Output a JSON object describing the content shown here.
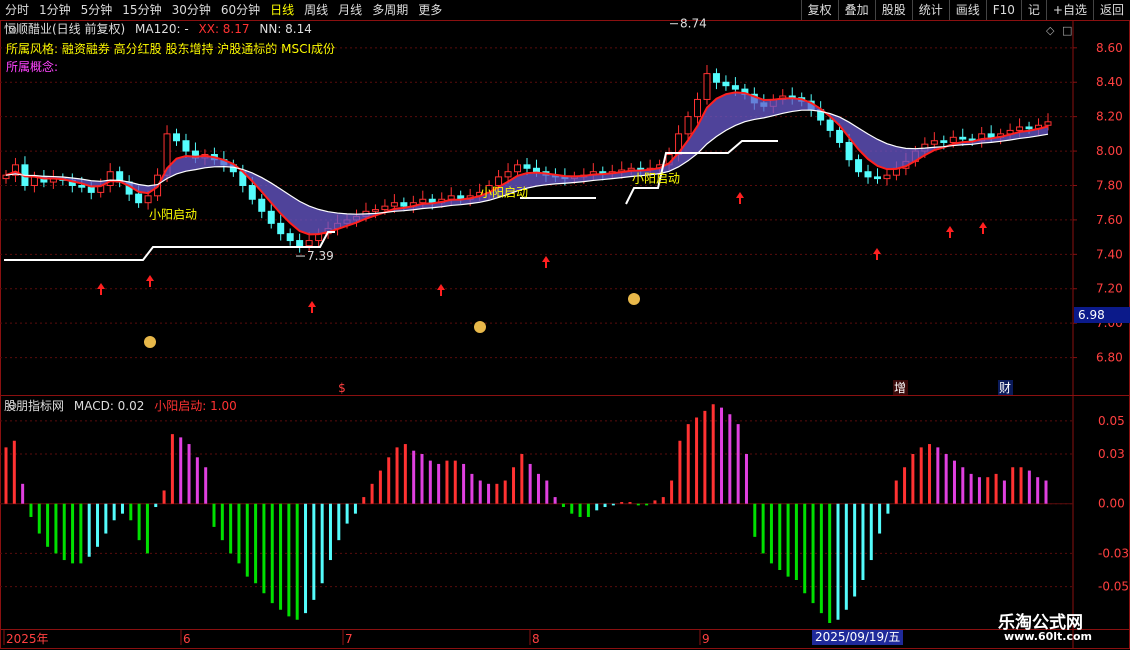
{
  "toolbar": {
    "periods": [
      "分时",
      "1分钟",
      "5分钟",
      "15分钟",
      "30分钟",
      "60分钟",
      "日线",
      "周线",
      "月线",
      "多周期",
      "更多"
    ],
    "active": "日线",
    "buttons": [
      "复权",
      "叠加",
      "股股",
      "统计",
      "画线",
      "F10",
      "记",
      "+自选",
      "返回"
    ]
  },
  "info": {
    "stock": "恒顺醋业(日线 前复权)",
    "ma": "MA120: -",
    "xx": "XX: 8.17",
    "nn": "NN: 8.14"
  },
  "tags": {
    "line1": "所属风格:  融资融券 高分红股 股东增持 沪股通标的 MSCI成份",
    "line2": "所属概念:"
  },
  "lower": {
    "name": "股朋指标网",
    "macd": "MACD: 0.02",
    "signal": "小阳启动: 1.00"
  },
  "price_tag": "6.98",
  "date_highlight": "2025/09/19/五",
  "watermark": {
    "line1": "乐淘公式网",
    "line2": "www.60lt.com"
  },
  "colors": {
    "up": "#ff3232",
    "down": "#54fcfc",
    "macd_up": "#ff3232",
    "macd_up2": "#e040e0",
    "macd_down": "#00e000",
    "macd_down2": "#54fcfc"
  },
  "chart_data": [
    {
      "type": "candlestick",
      "title": "",
      "ylim": [
        6.6,
        8.75
      ],
      "y_ticks": [
        6.8,
        7.0,
        7.2,
        7.4,
        7.6,
        7.8,
        8.0,
        8.2,
        8.4,
        8.6
      ],
      "x_labels": [
        "2025年",
        "6",
        "7",
        "8",
        "9"
      ],
      "close_estimate": [
        7.86,
        7.92,
        7.8,
        7.85,
        7.82,
        7.84,
        7.83,
        7.8,
        7.79,
        7.76,
        7.8,
        7.88,
        7.82,
        7.75,
        7.7,
        7.74,
        7.86,
        8.1,
        8.06,
        8.0,
        7.96,
        7.98,
        7.95,
        7.92,
        7.88,
        7.8,
        7.72,
        7.65,
        7.58,
        7.52,
        7.48,
        7.45,
        7.48,
        7.52,
        7.55,
        7.58,
        7.6,
        7.62,
        7.65,
        7.66,
        7.68,
        7.7,
        7.68,
        7.7,
        7.72,
        7.7,
        7.72,
        7.74,
        7.72,
        7.74,
        7.76,
        7.8,
        7.85,
        7.88,
        7.92,
        7.9,
        7.88,
        7.86,
        7.85,
        7.84,
        7.85,
        7.86,
        7.88,
        7.87,
        7.88,
        7.89,
        7.9,
        7.89,
        7.9,
        7.92,
        7.98,
        8.1,
        8.2,
        8.3,
        8.45,
        8.4,
        8.38,
        8.36,
        8.33,
        8.28,
        8.26,
        8.3,
        8.32,
        8.31,
        8.29,
        8.24,
        8.18,
        8.12,
        8.05,
        7.95,
        7.88,
        7.85,
        7.84,
        7.86,
        7.9,
        7.94,
        8.0,
        8.04,
        8.06,
        8.05,
        8.08,
        8.07,
        8.06,
        8.1,
        8.08,
        8.1,
        8.12,
        8.14,
        8.13,
        8.15,
        8.17
      ],
      "annotations": [
        {
          "label": "8.74",
          "value": 8.74
        },
        {
          "label": "7.39",
          "value": 7.39
        },
        {
          "label": "小阳启动",
          "value": 7.63
        },
        {
          "label": "小阳启动",
          "value": 7.76
        },
        {
          "label": "小阳启动",
          "value": 7.84
        }
      ],
      "markers": [
        "$",
        "增",
        "财"
      ]
    },
    {
      "type": "bar",
      "title": "",
      "ylim": [
        -0.075,
        0.065
      ],
      "y_ticks": [
        0.05,
        0.03,
        0.0,
        -0.03,
        -0.05
      ],
      "values": [
        0.034,
        0.038,
        0.012,
        -0.008,
        -0.018,
        -0.026,
        -0.03,
        -0.034,
        -0.036,
        -0.036,
        -0.032,
        -0.026,
        -0.018,
        -0.01,
        -0.006,
        -0.01,
        -0.022,
        -0.03,
        -0.002,
        0.008,
        0.042,
        0.04,
        0.036,
        0.028,
        0.022,
        -0.014,
        -0.022,
        -0.03,
        -0.036,
        -0.044,
        -0.048,
        -0.054,
        -0.06,
        -0.064,
        -0.068,
        -0.07,
        -0.066,
        -0.058,
        -0.048,
        -0.034,
        -0.022,
        -0.012,
        -0.006,
        0.004,
        0.012,
        0.02,
        0.028,
        0.034,
        0.036,
        0.032,
        0.03,
        0.026,
        0.024,
        0.026,
        0.026,
        0.024,
        0.018,
        0.014,
        0.012,
        0.012,
        0.014,
        0.022,
        0.03,
        0.024,
        0.018,
        0.014,
        0.004,
        -0.002,
        -0.006,
        -0.008,
        -0.008,
        -0.004,
        -0.002,
        -0.001,
        0.001,
        0.001,
        -0.001,
        -0.001,
        0.002,
        0.004,
        0.014,
        0.038,
        0.048,
        0.052,
        0.056,
        0.06,
        0.058,
        0.054,
        0.048,
        0.03,
        -0.02,
        -0.03,
        -0.036,
        -0.04,
        -0.044,
        -0.046,
        -0.054,
        -0.06,
        -0.066,
        -0.072,
        -0.07,
        -0.064,
        -0.056,
        -0.046,
        -0.034,
        -0.018,
        -0.006,
        0.014,
        0.022,
        0.03,
        0.034,
        0.036,
        0.034,
        0.03,
        0.026,
        0.022,
        0.018,
        0.016,
        0.016,
        0.018,
        0.014,
        0.022,
        0.022,
        0.02,
        0.016,
        0.014
      ]
    }
  ]
}
